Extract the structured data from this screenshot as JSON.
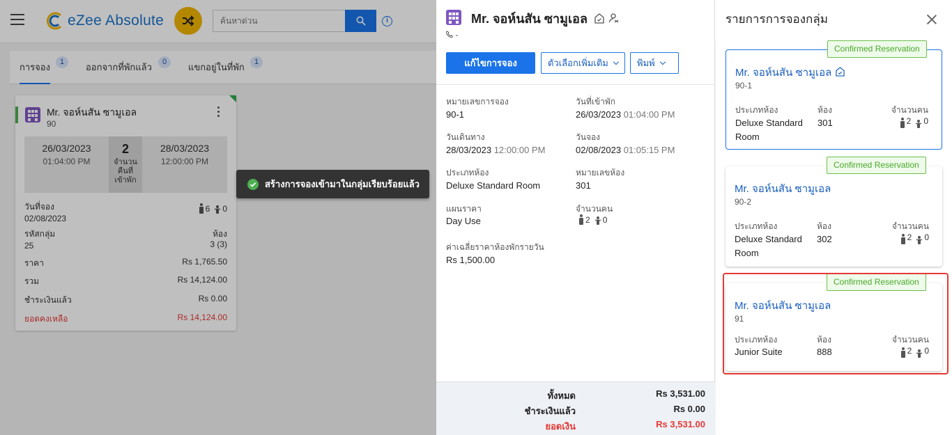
{
  "app": {
    "brand": "eZee Absolute"
  },
  "search": {
    "placeholder": "ค้นหาด่วน"
  },
  "tabs": [
    {
      "label": "การจอง",
      "count": "1"
    },
    {
      "label": "ออกจากที่พักแล้ว",
      "count": "0"
    },
    {
      "label": "แขกอยู่ในที่พัก",
      "count": "1"
    }
  ],
  "reservation_card": {
    "guest": "Mr. จอห์นสัน ซามูเอล",
    "number": "90",
    "arrival_date": "26/03/2023",
    "arrival_time": "01:04:00 PM",
    "nights": "2",
    "nights_label": [
      "จำนวน",
      "คืนที่",
      "เข้าพัก"
    ],
    "departure_date": "28/03/2023",
    "departure_time": "12:00:00 PM",
    "booking_date_label": "วันที่จอง",
    "booking_date": "02/08/2023",
    "adults": "6",
    "children": "0",
    "group_code_label": "รหัสกลุ่ม",
    "group_code": "25",
    "rooms_label": "ห้อง",
    "rooms": "3 (3)",
    "rate_label": "ราคา",
    "rate": "Rs 1,765.50",
    "total_label": "รวม",
    "total": "Rs 14,124.00",
    "paid_label": "ชำระเงินแล้ว",
    "paid": "Rs 0.00",
    "balance_label": "ยอดคงเหลือ",
    "balance": "Rs 14,124.00"
  },
  "toast": {
    "message": "สร้างการจองเข้ามาในกลุ่มเรียบร้อยแล้ว"
  },
  "detail": {
    "title": "Mr. จอห์นสัน ซามูเอล",
    "phone": "-",
    "edit_button": "แก้ไขการจอง",
    "more_options_button": "ตัวเลือกเพิ่มเติม",
    "print_button": "พิมพ์",
    "fields": {
      "res_no_label": "หมายเลขการจอง",
      "res_no": "90-1",
      "checkin_label": "วันที่เข้าพัก",
      "checkin_date": "26/03/2023",
      "checkin_time": "01:04:00 PM",
      "departure_label": "วันเดินทาง",
      "departure_date": "28/03/2023",
      "departure_time": "12:00:00 PM",
      "booking_label": "วันจอง",
      "booking_date": "02/08/2023",
      "booking_time": "01:05:15 PM",
      "room_type_label": "ประเภทห้อง",
      "room_type": "Deluxe Standard Room",
      "room_no_label": "หมายเลขห้อง",
      "room_no": "301",
      "rate_plan_label": "แผนราคา",
      "rate_plan": "Day Use",
      "pax_label": "จำนวนคน",
      "adults": "2",
      "children": "0",
      "avg_rate_label": "ค่าเฉลี่ยราคาห้องพักรายวัน",
      "avg_rate": "Rs 1,500.00"
    },
    "totals": {
      "total_label": "ทั้งหมด",
      "total": "Rs 3,531.00",
      "paid_label": "ชำระเงินแล้ว",
      "paid": "Rs 0.00",
      "balance_label": "ยอดเงิน",
      "balance": "Rs 3,531.00"
    }
  },
  "group_panel": {
    "title": "รายการการจองกลุ่ม",
    "room_type_label": "ประเภทห้อง",
    "room_label": "ห้อง",
    "pax_label": "จำนวนคน",
    "cards": [
      {
        "status": "Confirmed Reservation",
        "guest": "Mr. จอห์นสัน ซามูเอล",
        "number": "90-1",
        "room_type_line1": "Deluxe Standard",
        "room_type_line2": "Room",
        "room": "301",
        "adults": "2",
        "children": "0"
      },
      {
        "status": "Confirmed Reservation",
        "guest": "Mr. จอห์นสัน ซามูเอล",
        "number": "90-2",
        "room_type_line1": "Deluxe Standard",
        "room_type_line2": "Room",
        "room": "302",
        "adults": "2",
        "children": "0"
      },
      {
        "status": "Confirmed Reservation",
        "guest": "Mr. จอห์นสัน ซามูเอล",
        "number": "91",
        "room_type_line1": "Junior Suite",
        "room_type_line2": "",
        "room": "888",
        "adults": "2",
        "children": "0"
      }
    ]
  },
  "colors": {
    "primary": "#1a73e8",
    "accent": "#f0b400",
    "confirmed": "#49a82a",
    "danger": "#e53935",
    "hotel_icon": "#7e57c2"
  }
}
